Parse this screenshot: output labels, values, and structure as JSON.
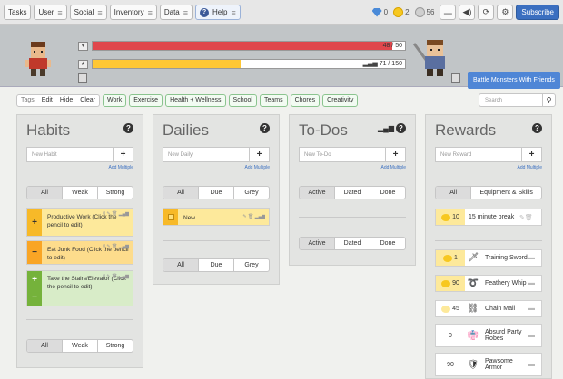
{
  "topbar": {
    "tasks": "Tasks",
    "user": "User",
    "social": "Social",
    "inventory": "Inventory",
    "data": "Data",
    "help": "Help",
    "gems": "0",
    "gold": "2",
    "silver": "56",
    "subscribe": "Subscribe"
  },
  "header": {
    "hp": "48 / 50",
    "hp_fraction": 0.96,
    "xp": "71 / 150",
    "xp_fraction": 0.473,
    "battle": "Battle Monsters With Friends"
  },
  "filters": {
    "tags": "Tags",
    "edit": "Edit",
    "hide": "Hide",
    "clear": "Clear",
    "chips": [
      "Work",
      "Exercise",
      "Health + Wellness",
      "School",
      "Teams",
      "Chores",
      "Creativity"
    ],
    "search_placeholder": "Search"
  },
  "habits": {
    "title": "Habits",
    "new_placeholder": "New Habit",
    "add_multiple": "Add Multiple",
    "tabs": [
      "All",
      "Weak",
      "Strong"
    ],
    "tasks": [
      {
        "text": "Productive Work (Click the pencil to edit)",
        "count": "0"
      },
      {
        "text": "Eat Junk Food (Click the pencil to edit)",
        "count": "0"
      },
      {
        "text": "Take the Stairs/Elevator (Click the pencil to edit)",
        "count": "0"
      }
    ]
  },
  "dailies": {
    "title": "Dailies",
    "new_placeholder": "New Daily",
    "add_multiple": "Add Multiple",
    "tabs": [
      "All",
      "Due",
      "Grey"
    ],
    "tasks": [
      {
        "text": "New"
      }
    ]
  },
  "todos": {
    "title": "To-Dos",
    "new_placeholder": "New To-Do",
    "add_multiple": "Add Multiple",
    "tabs": [
      "Active",
      "Dated",
      "Done"
    ]
  },
  "rewards": {
    "title": "Rewards",
    "new_placeholder": "New Reward",
    "add_multiple": "Add Multiple",
    "tabs": [
      "All",
      "Equipment & Skills"
    ],
    "custom": [
      {
        "price": "10",
        "name": "15 minute break"
      }
    ],
    "items": [
      {
        "price": "1",
        "name": "Training Sword",
        "icon": "sword-icon"
      },
      {
        "price": "90",
        "name": "Feathery Whip",
        "icon": "whip-icon"
      },
      {
        "price": "45",
        "name": "Chain Mail",
        "icon": "chainmail-icon"
      },
      {
        "price": "0",
        "name": "Absurd Party Robes",
        "icon": "robes-icon"
      },
      {
        "price": "90",
        "name": "Pawsome Armor",
        "icon": "armor-icon"
      }
    ]
  }
}
